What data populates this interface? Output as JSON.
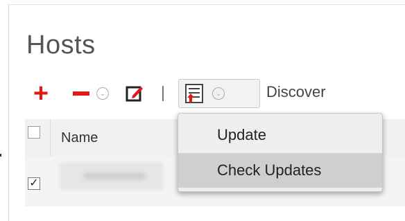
{
  "page": {
    "title": "Hosts"
  },
  "toolbar": {
    "add_icon": "plus-icon",
    "remove_icon": "minus-icon",
    "edit_icon": "edit-icon",
    "update_icon": "host-update-icon",
    "discover_label": "Discover",
    "colors": {
      "add_remove": "#e01818"
    }
  },
  "table": {
    "columns": [
      "",
      "Name"
    ],
    "rows": [
      {
        "checked": true,
        "name_redacted": true
      }
    ]
  },
  "update_menu": {
    "items": [
      {
        "label": "Update"
      },
      {
        "label": "Check Updates",
        "highlighted": true
      }
    ]
  }
}
